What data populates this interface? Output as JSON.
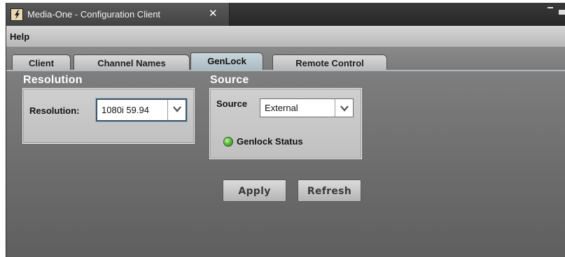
{
  "window": {
    "title": "Media-One - Configuration Client",
    "close_glyph": "✕",
    "icon": "app-logo-icon"
  },
  "menu": {
    "items": [
      {
        "label": "Help"
      }
    ]
  },
  "tabs": [
    {
      "label": "Client",
      "active": false
    },
    {
      "label": "Channel Names",
      "active": false
    },
    {
      "label": "GenLock",
      "active": true
    },
    {
      "label": "Remote Control",
      "active": false
    }
  ],
  "resolution_section": {
    "title": "Resolution",
    "field_label": "Resolution:",
    "selected_value": "1080i 59.94"
  },
  "source_section": {
    "title": "Source",
    "field_label": "Source",
    "selected_value": "External",
    "status_label": "Genlock Status",
    "status_color": "#5fbf3f"
  },
  "buttons": {
    "apply": "Apply",
    "refresh": "Refresh"
  },
  "colors": {
    "background": "#6e6e6e",
    "active_tab": "#b4c4cb",
    "panel": "#c8c8c8"
  }
}
